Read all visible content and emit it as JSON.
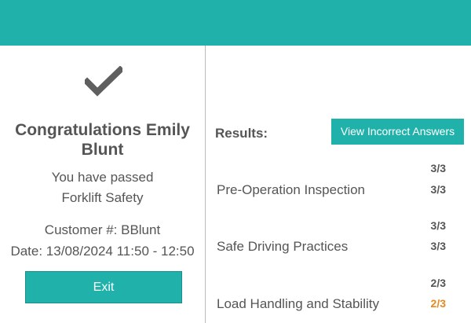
{
  "summary": {
    "congrats_line1": "Congratulations Emily",
    "congrats_line2": "Blunt",
    "passed_line1": "You have passed",
    "passed_line2": "Forklift Safety",
    "customer": "Customer #: BBlunt",
    "date": "Date: 13/08/2024 11:50 - 12:50",
    "exit_label": "Exit",
    "check_icon": "checkmark-icon"
  },
  "results": {
    "label": "Results:",
    "view_incorrect_label": "View Incorrect Answers",
    "sections": [
      {
        "name": "Pre-Operation Inspection",
        "score_top": "3/3",
        "score_bottom": "3/3",
        "score_bottom_color": "#555555"
      },
      {
        "name": "Safe Driving Practices",
        "score_top": "3/3",
        "score_bottom": "3/3",
        "score_bottom_color": "#555555"
      },
      {
        "name": "Load Handling and Stability",
        "score_top": "2/3",
        "score_bottom": "2/3",
        "score_bottom_color": "#e8891e"
      }
    ]
  },
  "colors": {
    "accent": "#20b2aa",
    "warning": "#e8891e",
    "text": "#555555"
  }
}
